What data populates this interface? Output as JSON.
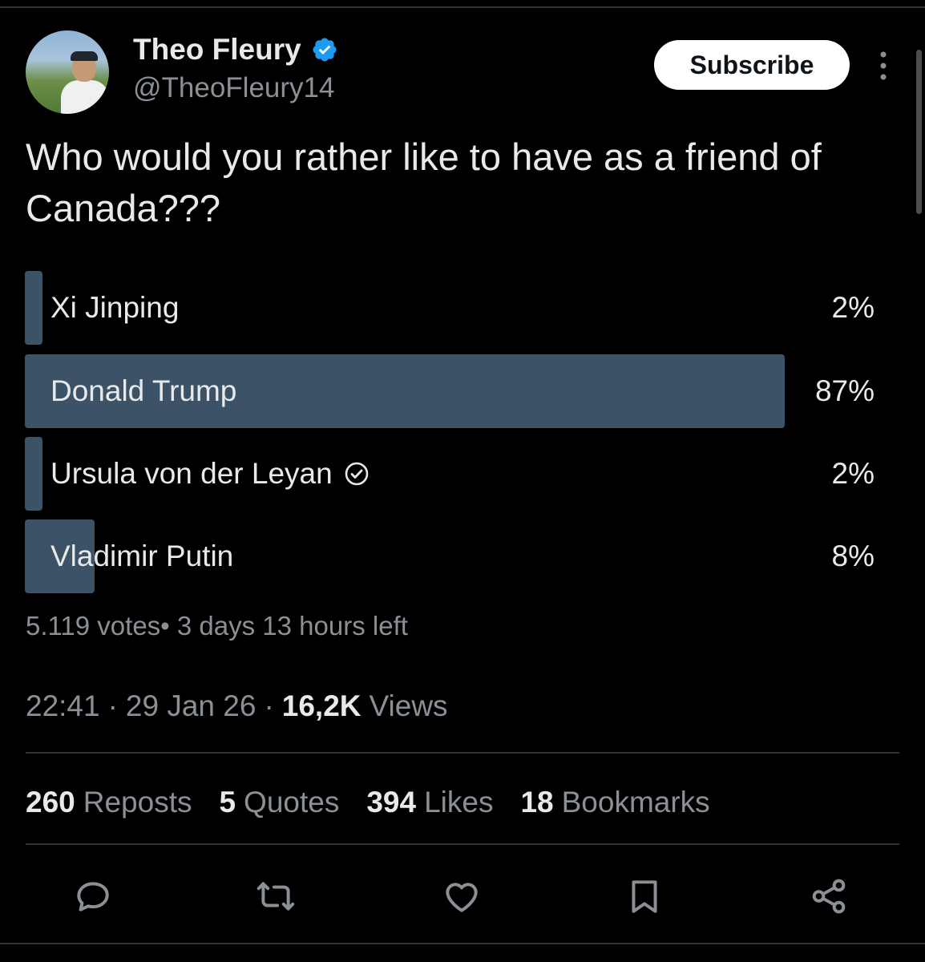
{
  "author": {
    "display_name": "Theo Fleury",
    "handle": "@TheoFleury14",
    "verified_icon": "verified-badge-icon",
    "verified_color": "#1d9bf0"
  },
  "subscribe_label": "Subscribe",
  "tweet_text": "Who would you rather like to have as a friend of Canada???",
  "poll": {
    "options": [
      {
        "label": "Xi Jinping",
        "percent_text": "2%",
        "percent": 2,
        "leading": false
      },
      {
        "label": "Donald Trump",
        "percent_text": "87%",
        "percent": 87,
        "leading": true
      },
      {
        "label": "Ursula von der Leyan",
        "percent_text": "2%",
        "percent": 2,
        "leading": false,
        "selected_icon": "check-circle-icon"
      },
      {
        "label": "Vladimir Putin",
        "percent_text": "8%",
        "percent": 8,
        "leading": false
      }
    ],
    "bar_color": "#3c5266",
    "meta": "5.119 votes• 3 days 13 hours left"
  },
  "timestamp": {
    "time": "22:41",
    "date": "29 Jan 26",
    "views_count": "16,2K",
    "views_label": "Views"
  },
  "stats": {
    "reposts": {
      "count": "260",
      "label": "Reposts"
    },
    "quotes": {
      "count": "5",
      "label": "Quotes"
    },
    "likes": {
      "count": "394",
      "label": "Likes"
    },
    "bookmarks": {
      "count": "18",
      "label": "Bookmarks"
    }
  },
  "actions": [
    "reply-icon",
    "retweet-icon",
    "like-icon",
    "bookmark-icon",
    "share-icon"
  ],
  "colors": {
    "background": "#000000",
    "text_primary": "#e7e9ea",
    "text_secondary": "#8b9096",
    "divider": "#2f3336"
  }
}
